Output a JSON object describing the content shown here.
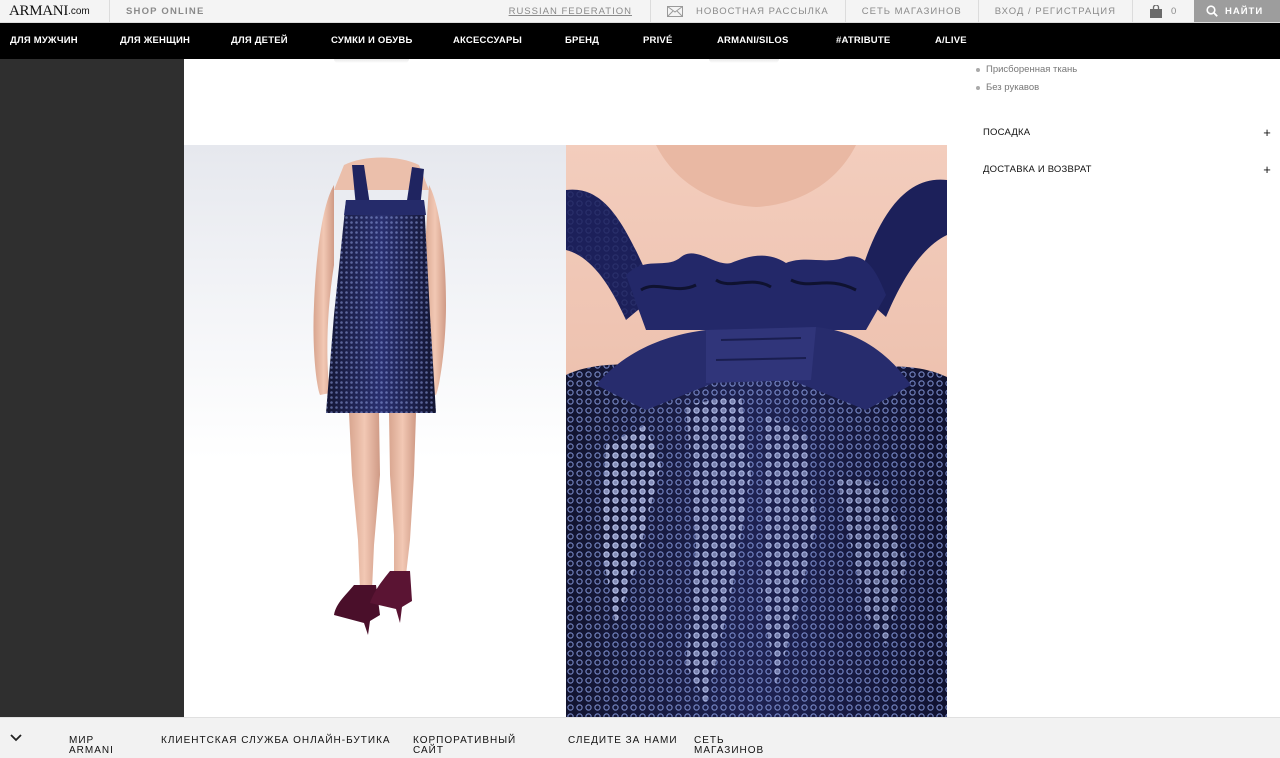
{
  "topbar": {
    "logo_main": "ARMANI",
    "logo_domain": ".com",
    "shop_online": "SHOP ONLINE",
    "country": "RUSSIAN FEDERATION",
    "newsletter": "НОВОСТНАЯ РАССЫЛКА",
    "stores": "СЕТЬ МАГАЗИНОВ",
    "login": "ВХОД / РЕГИСТРАЦИЯ",
    "cart_count": "0",
    "search": "НАЙТИ"
  },
  "nav": {
    "items": [
      "ДЛЯ МУЖЧИН",
      "ДЛЯ ЖЕНЩИН",
      "ДЛЯ ДЕТЕЙ",
      "СУМКИ И ОБУВЬ",
      "АКСЕССУАРЫ",
      "БРЕНД",
      "PRIVÉ",
      "ARMANI/SILOS",
      "#ATRIBUTE",
      "A/LIVE"
    ]
  },
  "details": {
    "bullets": [
      "Присборенная ткань",
      "Без рукавов"
    ],
    "accordions": [
      {
        "label": "ПОСАДКА",
        "toggle": "+"
      },
      {
        "label": "ДОСТАВКА И ВОЗВРАТ",
        "toggle": "+"
      }
    ]
  },
  "footer": {
    "items": [
      {
        "line1": "МИР",
        "line2": "ARMANI"
      },
      {
        "line1": "КЛИЕНТСКАЯ СЛУЖБА ОНЛАЙН-БУТИКА",
        "line2": ""
      },
      {
        "line1": "КОРПОРАТИВНЫЙ",
        "line2": "САЙТ"
      },
      {
        "line1": "СЛЕДИТЕ ЗА НАМИ",
        "line2": ""
      },
      {
        "line1": "СЕТЬ",
        "line2": "МАГАЗИНОВ"
      }
    ]
  },
  "colors": {
    "dress_navy": "#1e2150",
    "sequin": "#7d8fd0",
    "skin": "#eec0ad",
    "nav_bg": "#000000",
    "left_panel": "#2f2f2f"
  }
}
